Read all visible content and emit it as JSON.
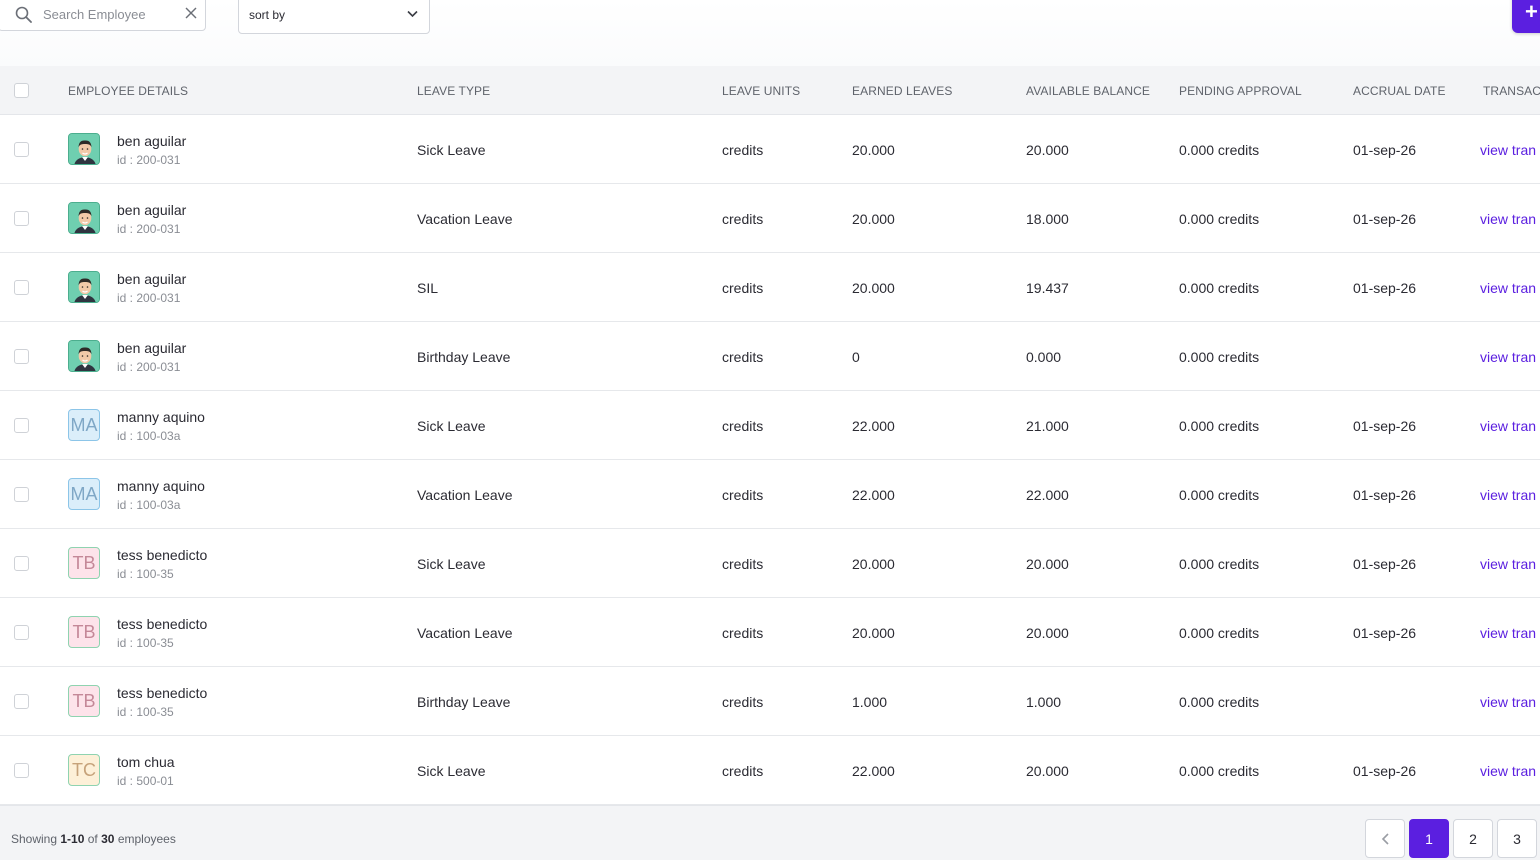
{
  "search": {
    "placeholder": "Search Employee"
  },
  "sort": {
    "label": "sort by"
  },
  "add_button": {
    "label": "+"
  },
  "table": {
    "headers": {
      "employee_details": "EMPLOYEE DETAILS",
      "leave_type": "LEAVE TYPE",
      "leave_units": "LEAVE UNITS",
      "earned_leaves": "EARNED LEAVES",
      "available_balance": "AVAILABLE BALANCE",
      "pending_approval": "PENDING APPROVAL",
      "accrual_date": "ACCRUAL DATE",
      "transactions": "TRANSACT"
    },
    "rows": [
      {
        "name": "ben aguilar",
        "id": "id : 200-031",
        "avatar": "photo",
        "leave_type": "Sick Leave",
        "units": "credits",
        "earned": "20.000",
        "balance": "20.000",
        "pending": "0.000 credits",
        "accrual": "01-sep-26",
        "link": "view tran"
      },
      {
        "name": "ben aguilar",
        "id": "id : 200-031",
        "avatar": "photo",
        "leave_type": "Vacation Leave",
        "units": "credits",
        "earned": "20.000",
        "balance": "18.000",
        "pending": "0.000 credits",
        "accrual": "01-sep-26",
        "link": "view tran"
      },
      {
        "name": "ben aguilar",
        "id": "id : 200-031",
        "avatar": "photo",
        "leave_type": "SIL",
        "units": "credits",
        "earned": "20.000",
        "balance": "19.437",
        "pending": "0.000 credits",
        "accrual": "01-sep-26",
        "link": "view tran"
      },
      {
        "name": "ben aguilar",
        "id": "id : 200-031",
        "avatar": "photo",
        "leave_type": "Birthday Leave",
        "units": "credits",
        "earned": "0",
        "balance": "0.000",
        "pending": "0.000 credits",
        "accrual": "",
        "link": "view tran"
      },
      {
        "name": "manny aquino",
        "id": "id : 100-03a",
        "avatar": "MA",
        "avatar_bg": "#dbeefa",
        "avatar_fg": "#7fa7c6",
        "avatar_border": "#8cc5e8",
        "leave_type": "Sick Leave",
        "units": "credits",
        "earned": "22.000",
        "balance": "21.000",
        "pending": "0.000 credits",
        "accrual": "01-sep-26",
        "link": "view tran"
      },
      {
        "name": "manny aquino",
        "id": "id : 100-03a",
        "avatar": "MA",
        "avatar_bg": "#dbeefa",
        "avatar_fg": "#7fa7c6",
        "avatar_border": "#8cc5e8",
        "leave_type": "Vacation Leave",
        "units": "credits",
        "earned": "22.000",
        "balance": "22.000",
        "pending": "0.000 credits",
        "accrual": "01-sep-26",
        "link": "view tran"
      },
      {
        "name": "tess benedicto",
        "id": "id : 100-35",
        "avatar": "TB",
        "avatar_bg": "#fde3ea",
        "avatar_fg": "#c48898",
        "avatar_border": "#8fd3b0",
        "leave_type": "Sick Leave",
        "units": "credits",
        "earned": "20.000",
        "balance": "20.000",
        "pending": "0.000 credits",
        "accrual": "01-sep-26",
        "link": "view tran"
      },
      {
        "name": "tess benedicto",
        "id": "id : 100-35",
        "avatar": "TB",
        "avatar_bg": "#fde3ea",
        "avatar_fg": "#c48898",
        "avatar_border": "#8fd3b0",
        "leave_type": "Vacation Leave",
        "units": "credits",
        "earned": "20.000",
        "balance": "20.000",
        "pending": "0.000 credits",
        "accrual": "01-sep-26",
        "link": "view tran"
      },
      {
        "name": "tess benedicto",
        "id": "id : 100-35",
        "avatar": "TB",
        "avatar_bg": "#fde3ea",
        "avatar_fg": "#c48898",
        "avatar_border": "#8fd3b0",
        "leave_type": "Birthday Leave",
        "units": "credits",
        "earned": "1.000",
        "balance": "1.000",
        "pending": "0.000 credits",
        "accrual": "",
        "link": "view tran"
      },
      {
        "name": "tom chua",
        "id": "id : 500-01",
        "avatar": "TC",
        "avatar_bg": "#fdf0d8",
        "avatar_fg": "#c6a27a",
        "avatar_border": "#8fd3b0",
        "leave_type": "Sick Leave",
        "units": "credits",
        "earned": "22.000",
        "balance": "20.000",
        "pending": "0.000 credits",
        "accrual": "01-sep-26",
        "link": "view tran"
      }
    ]
  },
  "footer": {
    "showing_prefix": "Showing",
    "showing_range": "1-10",
    "showing_of": "of",
    "showing_total": "30",
    "showing_suffix": "employees",
    "prev_icon": "chevron-left-icon",
    "pages": [
      "1",
      "2",
      "3"
    ],
    "active_page": "1"
  },
  "colors": {
    "accent": "#5b1fe0",
    "link": "#5b1fe0"
  }
}
